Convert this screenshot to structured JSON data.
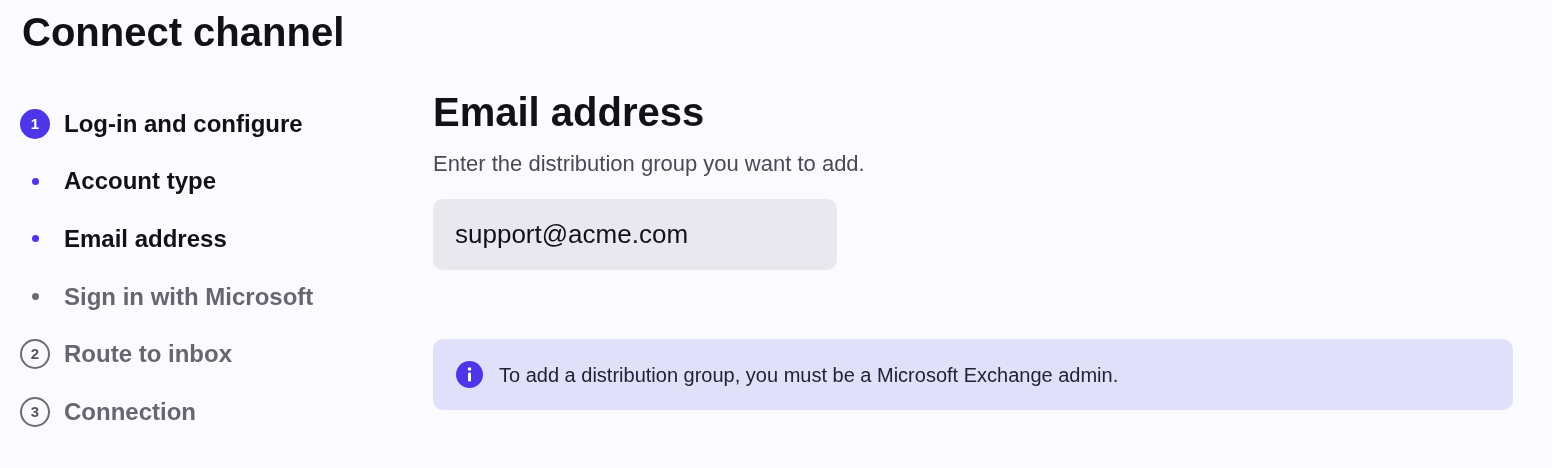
{
  "title": "Connect channel",
  "steps": [
    {
      "kind": "step",
      "number": "1",
      "label": "Log-in and configure",
      "active": true
    },
    {
      "kind": "substep",
      "label": "Account type",
      "active": true
    },
    {
      "kind": "substep",
      "label": "Email address",
      "active": true
    },
    {
      "kind": "substep",
      "label": "Sign in with Microsoft",
      "active": false
    },
    {
      "kind": "step",
      "number": "2",
      "label": "Route to inbox",
      "active": false
    },
    {
      "kind": "step",
      "number": "3",
      "label": "Connection",
      "active": false
    }
  ],
  "section": {
    "heading": "Email address",
    "description": "Enter the distribution group you want to add.",
    "email_field": {
      "value": "support@acme.com"
    },
    "notice": "To add a distribution group, you must be a Microsoft Exchange admin."
  }
}
